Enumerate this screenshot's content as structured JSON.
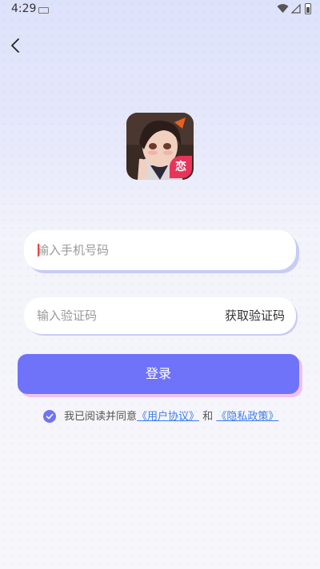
{
  "status_bar": {
    "time": "4:29"
  },
  "logo": {
    "badge": "恋"
  },
  "phone": {
    "placeholder": "输入手机号码"
  },
  "code": {
    "placeholder": "输入验证码",
    "get_code_label": "获取验证码"
  },
  "login": {
    "label": "登录"
  },
  "agreement": {
    "prefix": "我已阅读并同意",
    "user_agreement": "《用户协议》",
    "joiner": "和",
    "privacy_policy": "《隐私政策》",
    "checked": true
  },
  "colors": {
    "accent": "#6f73f9",
    "link": "#3d7df0",
    "badge": "#e8345a"
  }
}
